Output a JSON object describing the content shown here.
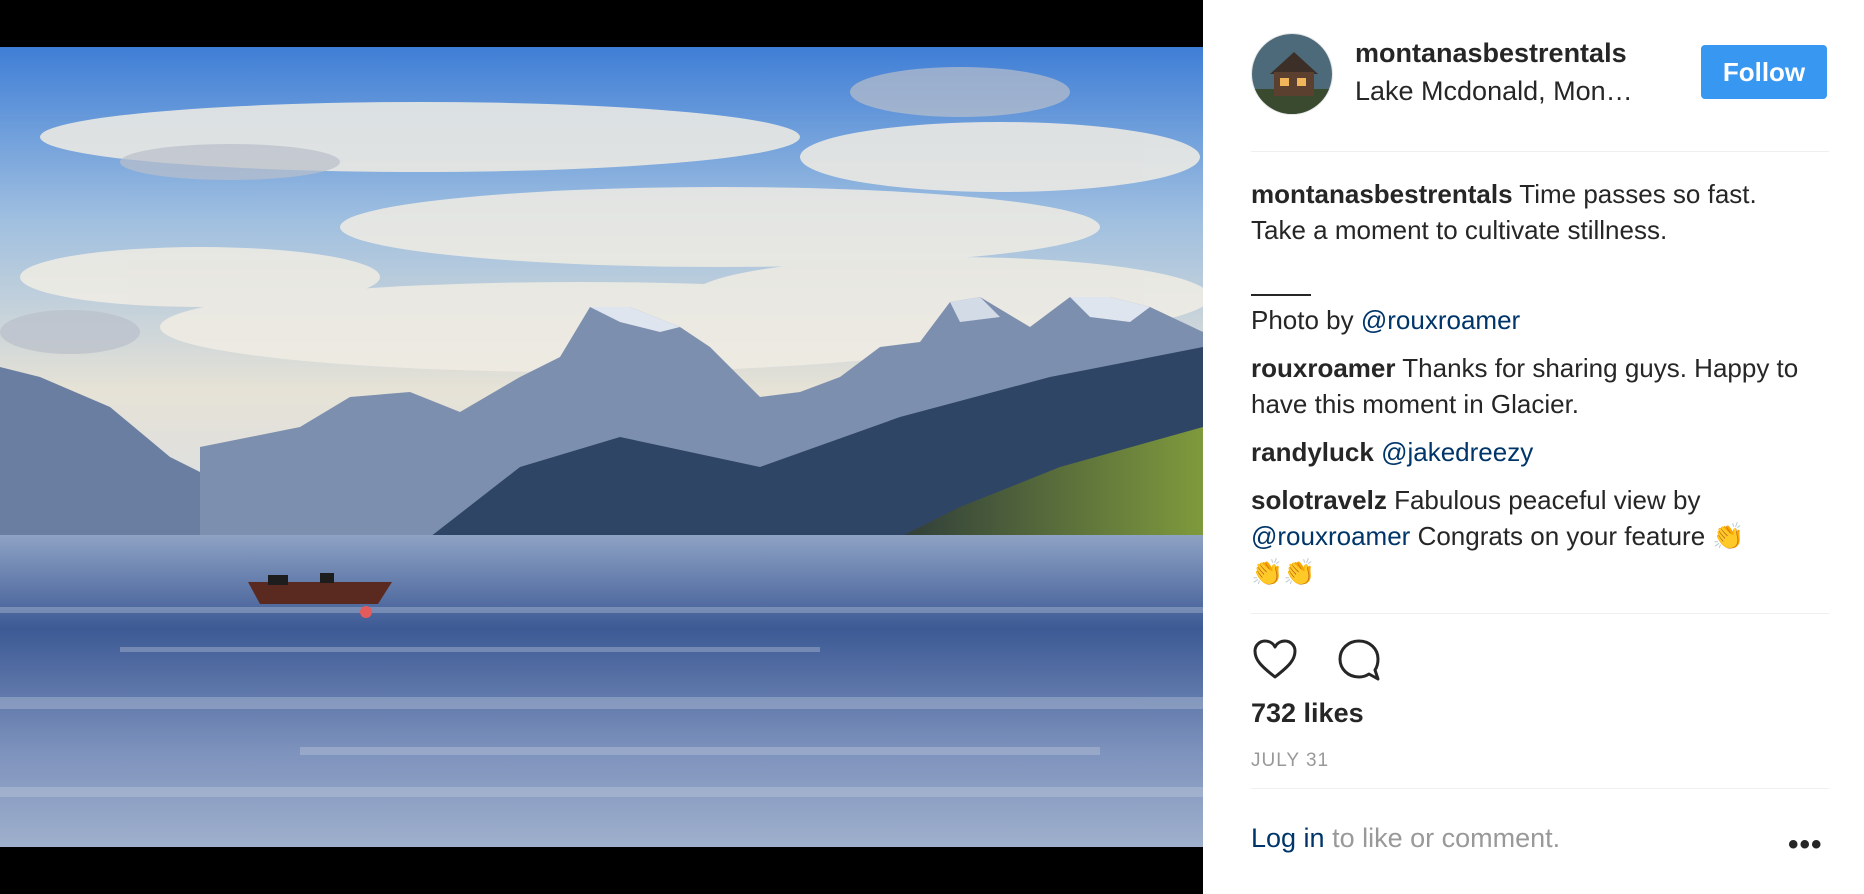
{
  "header": {
    "username": "montanasbestrentals",
    "location": "Lake Mcdonald, Mon…",
    "follow_label": "Follow"
  },
  "caption": {
    "username": "montanasbestrentals",
    "text_line1": "Time passes so fast.",
    "text_line2": "Take a moment to cultivate stillness.",
    "photo_by_prefix": "Photo by ",
    "photo_by_mention": "@rouxroamer"
  },
  "comments": [
    {
      "username": "rouxroamer",
      "text": "Thanks for sharing guys. Happy to have this moment in Glacier."
    },
    {
      "username": "randyluck",
      "mention": "@jakedreezy"
    },
    {
      "username": "solotravelz",
      "text": "Fabulous peaceful view by",
      "mention": "@rouxroamer",
      "text_after": "Congrats on your feature",
      "emoji": "👏",
      "emoji2": "👏👏"
    }
  ],
  "actions": {
    "like_icon": "heart-icon",
    "comment_icon": "comment-icon"
  },
  "likes_label": "732 likes",
  "date_label": "JULY 31",
  "footer": {
    "login_link": "Log in",
    "login_suffix": " to like or comment.",
    "more_label": "•••"
  },
  "colors": {
    "follow_button": "#3897f0",
    "mention": "#003569",
    "muted": "#999999",
    "text": "#262626"
  }
}
